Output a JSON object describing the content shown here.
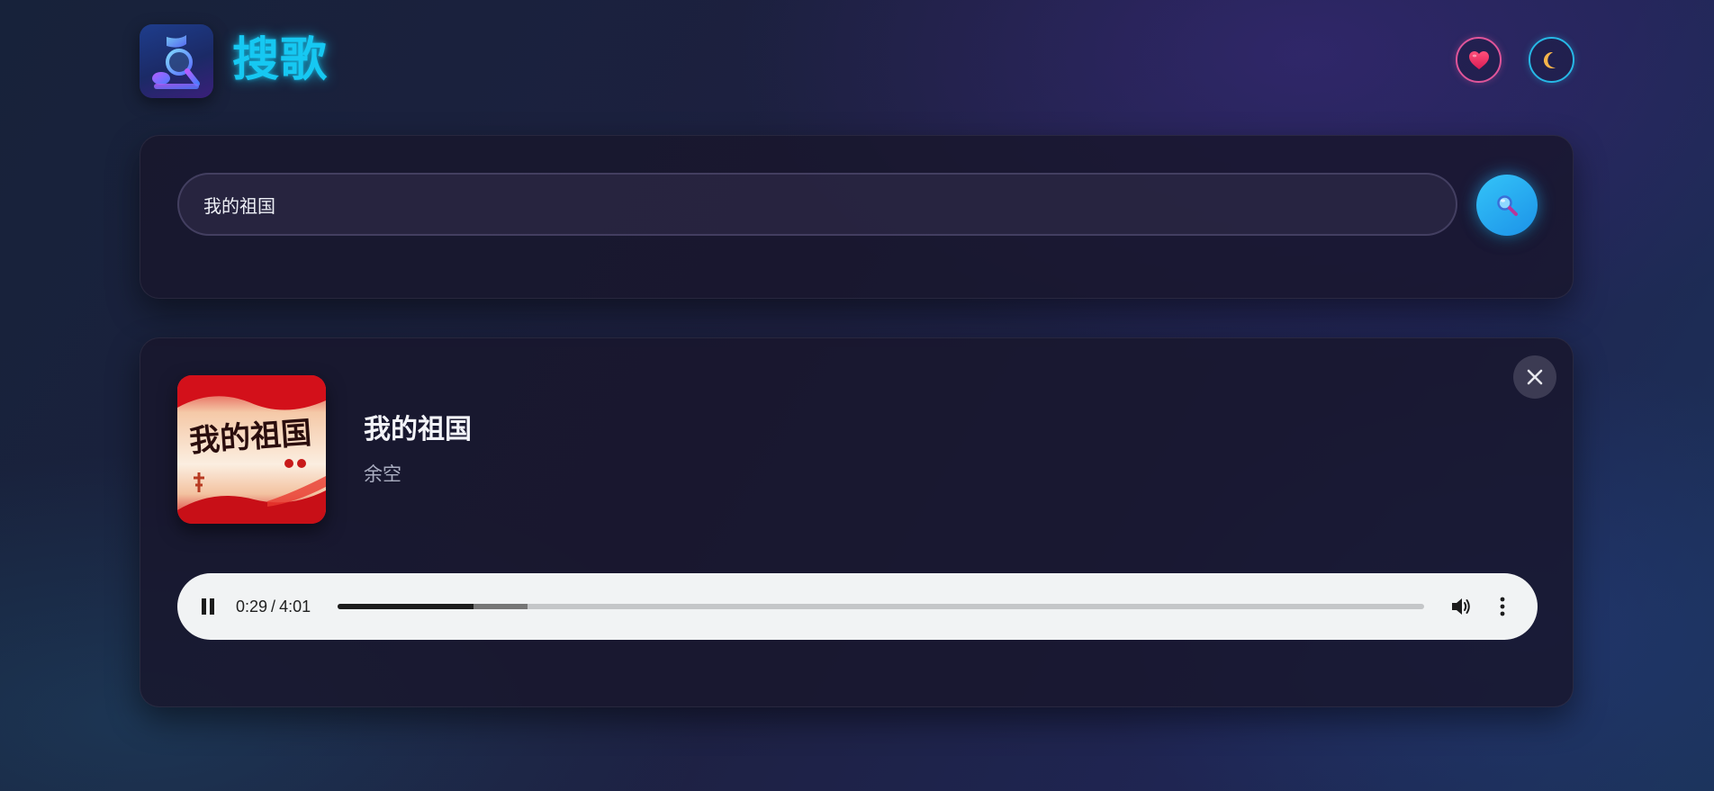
{
  "app": {
    "title": "搜歌",
    "logo_icon": "music-note-magnifier-icon",
    "accent_color": "#16c8f2"
  },
  "header": {
    "favorites_icon": "heart-icon",
    "theme_icon": "moon-icon"
  },
  "search": {
    "value": "我的祖国",
    "button_icon": "magnifier-icon"
  },
  "player": {
    "close_icon": "close-icon",
    "song": {
      "title": "我的祖国",
      "artist": "余空",
      "cover_text": "我的祖国"
    },
    "audio": {
      "state": "playing",
      "current_time": "0:29",
      "duration": "4:01",
      "separator": "/",
      "played_fraction": 0.125,
      "buffered_fraction": 0.175,
      "volume_icon": "volume-icon",
      "menu_icon": "more-vertical-icon"
    }
  }
}
